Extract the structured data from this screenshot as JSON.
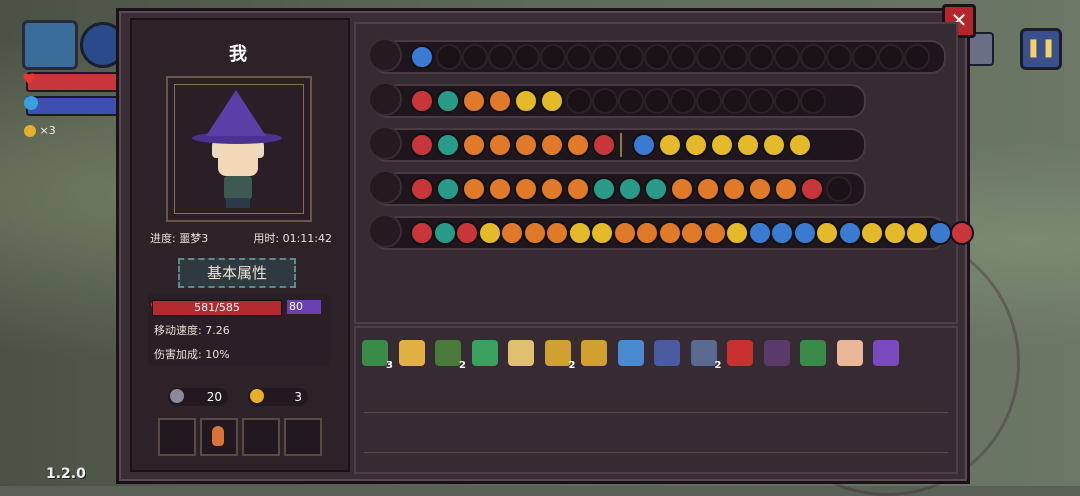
{
  "hud": {
    "coin_count": "×3",
    "version": "1.2.0"
  },
  "profile": {
    "name": "我",
    "progress_label": "进度: 噩梦3",
    "time_label": "用时: 01:11:42",
    "section_button": "基本属性",
    "hp_text": "581/585",
    "mp_value": "80",
    "move_speed": "移动速度: 7.26",
    "damage_bonus": "伤害加成: 10%",
    "keys": "20",
    "coins": "3"
  },
  "colors": {
    "red_gem": "#c8353a",
    "teal_gem": "#2a9a8a",
    "orange_gem": "#e07a2a",
    "gold_gem": "#e4b92a",
    "blue_gem": "#3a7ad0",
    "purple_gem": "#6a3fb0"
  },
  "weapon_rows": [
    {
      "icon": "chest-icon",
      "gems": [
        "blue"
      ],
      "empty_count": 20
    },
    {
      "icon": "staff-icon",
      "gems": [
        "red",
        "teal",
        "orange",
        "orange",
        "gold",
        "gold"
      ],
      "empty_count": 10
    },
    {
      "icon": "staff-icon",
      "gems": [
        "red",
        "teal",
        "orange",
        "orange",
        "orange",
        "orange",
        "orange",
        "red",
        "divider",
        "blue",
        "gold",
        "gold",
        "gold",
        "gold",
        "gold",
        "gold"
      ],
      "empty_count": 0
    },
    {
      "icon": "staff-icon",
      "gems": [
        "red",
        "teal",
        "orange",
        "orange",
        "orange",
        "orange",
        "orange",
        "teal",
        "teal",
        "teal",
        "orange",
        "orange",
        "orange",
        "orange",
        "orange",
        "red"
      ],
      "empty_count": 1
    },
    {
      "icon": "staff-icon",
      "gems": [
        "red",
        "teal",
        "red",
        "gold",
        "orange",
        "orange",
        "orange",
        "gold",
        "gold",
        "orange",
        "orange",
        "orange",
        "orange",
        "orange",
        "gold",
        "blue",
        "blue",
        "blue",
        "gold",
        "blue",
        "gold",
        "gold",
        "gold",
        "blue",
        "red"
      ],
      "empty_count": 0
    }
  ],
  "items": [
    {
      "name": "robe-item-icon",
      "count": "3",
      "color": "#3a8a4a"
    },
    {
      "name": "bird-item-icon",
      "count": "",
      "color": "#e0b040"
    },
    {
      "name": "cape-item-icon",
      "count": "2",
      "color": "#4a7a3a"
    },
    {
      "name": "helmet-item-icon",
      "count": "",
      "color": "#3aa060"
    },
    {
      "name": "horn-item-icon",
      "count": "",
      "color": "#e0c070"
    },
    {
      "name": "diamond-item-icon",
      "count": "2",
      "color": "#d0a030"
    },
    {
      "name": "bell-item-icon",
      "count": "",
      "color": "#d0a030"
    },
    {
      "name": "crystal-item-icon",
      "count": "",
      "color": "#4a8ad0"
    },
    {
      "name": "rune-item-icon",
      "count": "",
      "color": "#4a5aa0"
    },
    {
      "name": "stone-item-icon",
      "count": "2",
      "color": "#5a6a90"
    },
    {
      "name": "demon-item-icon",
      "count": "",
      "color": "#c83030"
    },
    {
      "name": "bug-item-icon",
      "count": "",
      "color": "#5a3a6a"
    },
    {
      "name": "boot-item-icon",
      "count": "",
      "color": "#3a8a4a"
    },
    {
      "name": "pig-item-icon",
      "count": "",
      "color": "#e8b898"
    },
    {
      "name": "hat-item-icon",
      "count": "",
      "color": "#7a4ac0"
    }
  ]
}
